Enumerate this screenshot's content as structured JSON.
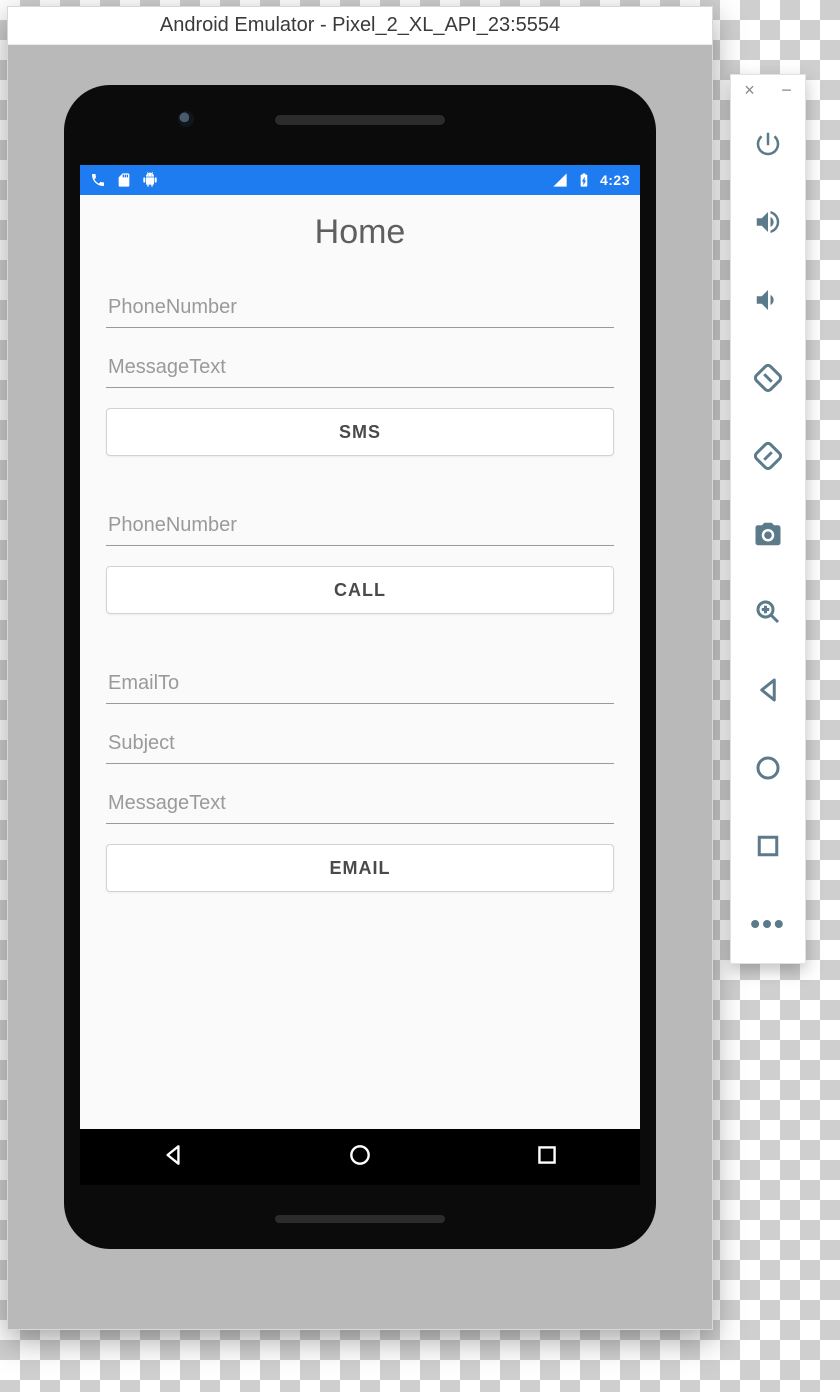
{
  "window": {
    "title": "Android Emulator - Pixel_2_XL_API_23:5554"
  },
  "status": {
    "time": "4:23"
  },
  "app": {
    "title": "Home",
    "sms": {
      "phone_placeholder": "PhoneNumber",
      "message_placeholder": "MessageText",
      "button": "SMS"
    },
    "call": {
      "phone_placeholder": "PhoneNumber",
      "button": "CALL"
    },
    "email": {
      "to_placeholder": "EmailTo",
      "subject_placeholder": "Subject",
      "message_placeholder": "MessageText",
      "button": "EMAIL"
    }
  },
  "toolbar": {
    "close": "×",
    "minimize": "−",
    "more": "•••"
  }
}
